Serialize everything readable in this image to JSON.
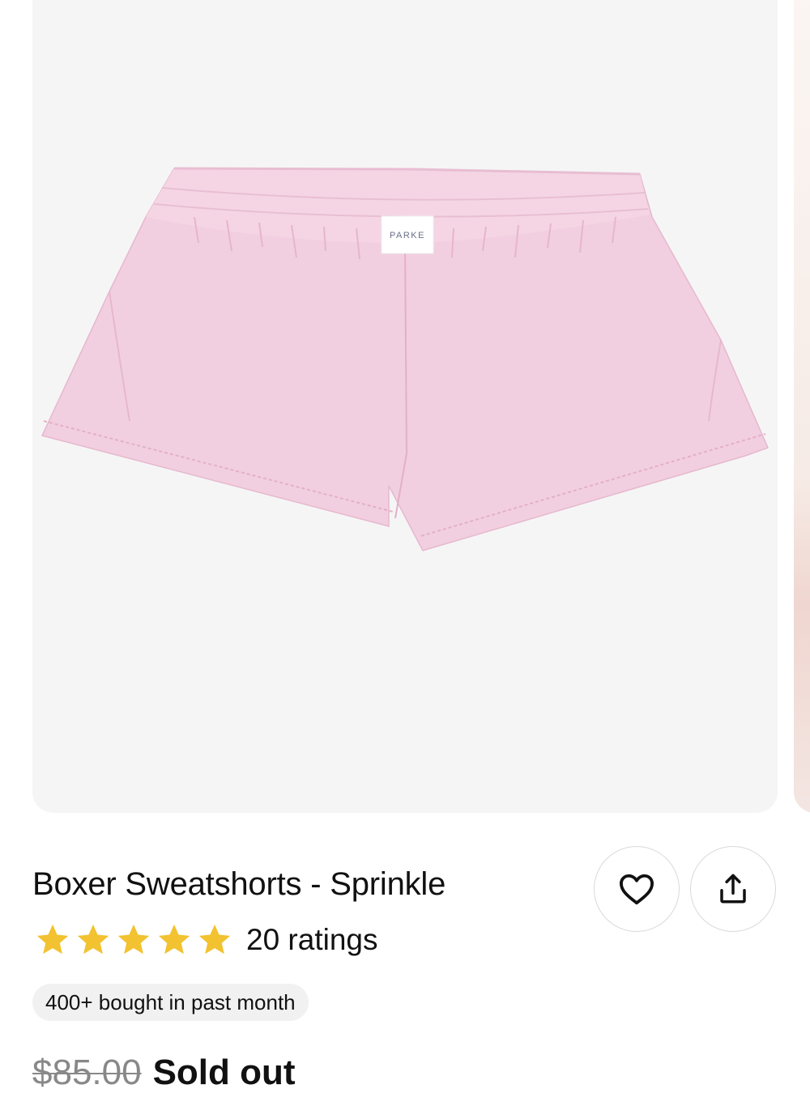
{
  "product": {
    "image_label_text": "PARKE",
    "title": "Boxer Sweatshorts - Sprinkle",
    "rating": 5,
    "rating_count_text": "20 ratings",
    "social_proof": "400+ bought in past month",
    "original_price": "$85.00",
    "availability": "Sold out"
  },
  "actions": {
    "favorite_icon": "heart-icon",
    "share_icon": "share-icon"
  },
  "colors": {
    "star": "#f2c230",
    "shorts": "#f2cfe0",
    "image_bg": "#f5f5f5"
  }
}
